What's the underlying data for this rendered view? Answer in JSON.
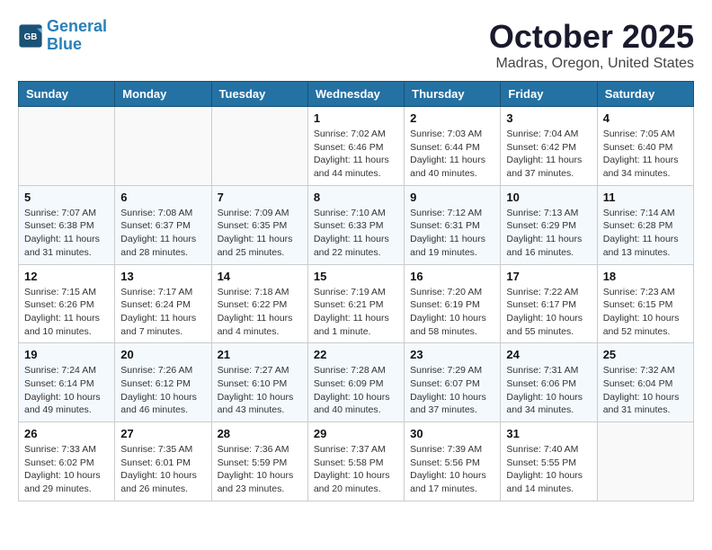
{
  "header": {
    "logo_line1": "General",
    "logo_line2": "Blue",
    "month": "October 2025",
    "location": "Madras, Oregon, United States"
  },
  "weekdays": [
    "Sunday",
    "Monday",
    "Tuesday",
    "Wednesday",
    "Thursday",
    "Friday",
    "Saturday"
  ],
  "weeks": [
    [
      {
        "day": "",
        "info": ""
      },
      {
        "day": "",
        "info": ""
      },
      {
        "day": "",
        "info": ""
      },
      {
        "day": "1",
        "info": "Sunrise: 7:02 AM\nSunset: 6:46 PM\nDaylight: 11 hours and 44 minutes."
      },
      {
        "day": "2",
        "info": "Sunrise: 7:03 AM\nSunset: 6:44 PM\nDaylight: 11 hours and 40 minutes."
      },
      {
        "day": "3",
        "info": "Sunrise: 7:04 AM\nSunset: 6:42 PM\nDaylight: 11 hours and 37 minutes."
      },
      {
        "day": "4",
        "info": "Sunrise: 7:05 AM\nSunset: 6:40 PM\nDaylight: 11 hours and 34 minutes."
      }
    ],
    [
      {
        "day": "5",
        "info": "Sunrise: 7:07 AM\nSunset: 6:38 PM\nDaylight: 11 hours and 31 minutes."
      },
      {
        "day": "6",
        "info": "Sunrise: 7:08 AM\nSunset: 6:37 PM\nDaylight: 11 hours and 28 minutes."
      },
      {
        "day": "7",
        "info": "Sunrise: 7:09 AM\nSunset: 6:35 PM\nDaylight: 11 hours and 25 minutes."
      },
      {
        "day": "8",
        "info": "Sunrise: 7:10 AM\nSunset: 6:33 PM\nDaylight: 11 hours and 22 minutes."
      },
      {
        "day": "9",
        "info": "Sunrise: 7:12 AM\nSunset: 6:31 PM\nDaylight: 11 hours and 19 minutes."
      },
      {
        "day": "10",
        "info": "Sunrise: 7:13 AM\nSunset: 6:29 PM\nDaylight: 11 hours and 16 minutes."
      },
      {
        "day": "11",
        "info": "Sunrise: 7:14 AM\nSunset: 6:28 PM\nDaylight: 11 hours and 13 minutes."
      }
    ],
    [
      {
        "day": "12",
        "info": "Sunrise: 7:15 AM\nSunset: 6:26 PM\nDaylight: 11 hours and 10 minutes."
      },
      {
        "day": "13",
        "info": "Sunrise: 7:17 AM\nSunset: 6:24 PM\nDaylight: 11 hours and 7 minutes."
      },
      {
        "day": "14",
        "info": "Sunrise: 7:18 AM\nSunset: 6:22 PM\nDaylight: 11 hours and 4 minutes."
      },
      {
        "day": "15",
        "info": "Sunrise: 7:19 AM\nSunset: 6:21 PM\nDaylight: 11 hours and 1 minute."
      },
      {
        "day": "16",
        "info": "Sunrise: 7:20 AM\nSunset: 6:19 PM\nDaylight: 10 hours and 58 minutes."
      },
      {
        "day": "17",
        "info": "Sunrise: 7:22 AM\nSunset: 6:17 PM\nDaylight: 10 hours and 55 minutes."
      },
      {
        "day": "18",
        "info": "Sunrise: 7:23 AM\nSunset: 6:15 PM\nDaylight: 10 hours and 52 minutes."
      }
    ],
    [
      {
        "day": "19",
        "info": "Sunrise: 7:24 AM\nSunset: 6:14 PM\nDaylight: 10 hours and 49 minutes."
      },
      {
        "day": "20",
        "info": "Sunrise: 7:26 AM\nSunset: 6:12 PM\nDaylight: 10 hours and 46 minutes."
      },
      {
        "day": "21",
        "info": "Sunrise: 7:27 AM\nSunset: 6:10 PM\nDaylight: 10 hours and 43 minutes."
      },
      {
        "day": "22",
        "info": "Sunrise: 7:28 AM\nSunset: 6:09 PM\nDaylight: 10 hours and 40 minutes."
      },
      {
        "day": "23",
        "info": "Sunrise: 7:29 AM\nSunset: 6:07 PM\nDaylight: 10 hours and 37 minutes."
      },
      {
        "day": "24",
        "info": "Sunrise: 7:31 AM\nSunset: 6:06 PM\nDaylight: 10 hours and 34 minutes."
      },
      {
        "day": "25",
        "info": "Sunrise: 7:32 AM\nSunset: 6:04 PM\nDaylight: 10 hours and 31 minutes."
      }
    ],
    [
      {
        "day": "26",
        "info": "Sunrise: 7:33 AM\nSunset: 6:02 PM\nDaylight: 10 hours and 29 minutes."
      },
      {
        "day": "27",
        "info": "Sunrise: 7:35 AM\nSunset: 6:01 PM\nDaylight: 10 hours and 26 minutes."
      },
      {
        "day": "28",
        "info": "Sunrise: 7:36 AM\nSunset: 5:59 PM\nDaylight: 10 hours and 23 minutes."
      },
      {
        "day": "29",
        "info": "Sunrise: 7:37 AM\nSunset: 5:58 PM\nDaylight: 10 hours and 20 minutes."
      },
      {
        "day": "30",
        "info": "Sunrise: 7:39 AM\nSunset: 5:56 PM\nDaylight: 10 hours and 17 minutes."
      },
      {
        "day": "31",
        "info": "Sunrise: 7:40 AM\nSunset: 5:55 PM\nDaylight: 10 hours and 14 minutes."
      },
      {
        "day": "",
        "info": ""
      }
    ]
  ]
}
